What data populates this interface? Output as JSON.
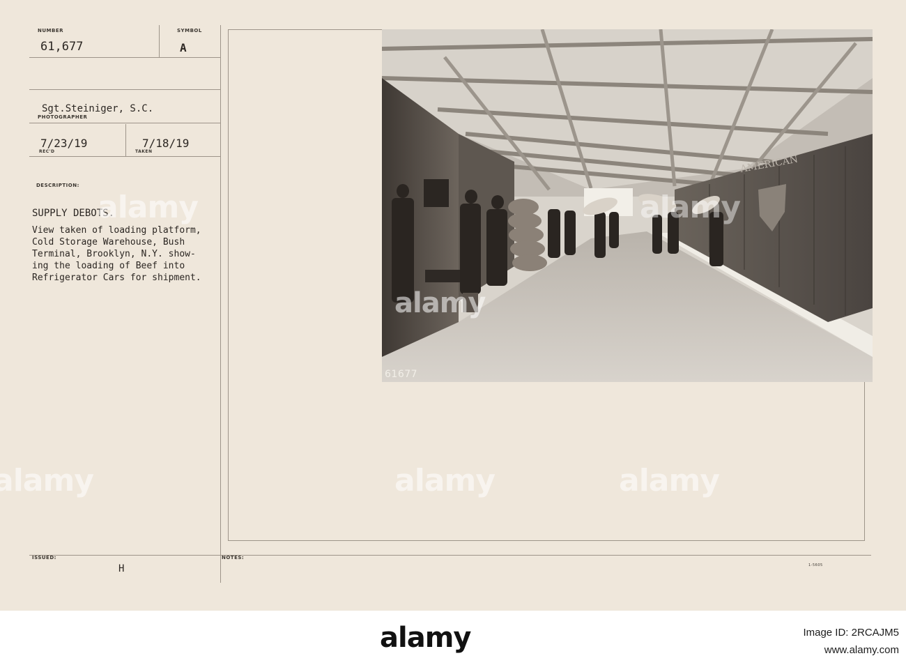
{
  "card": {
    "number_label": "NUMBER",
    "number_value": "61,677",
    "symbol_label": "SYMBOL",
    "symbol_value": "A",
    "photographer_value": "Sgt.Steiniger, S.C.",
    "photographer_label": "PHOTOGRAPHER",
    "received_value": "7/23/19",
    "received_label": "REC'D",
    "taken_value": "7/18/19",
    "taken_label": "TAKEN",
    "description_label": "DESCRIPTION:",
    "description_title": "SUPPLY DEBOTS.",
    "description_lines": [
      "View taken of loading platform,",
      "Cold Storage Warehouse, Bush",
      "Terminal, Brooklyn, N.Y. show-",
      "ing the loading of Beef into",
      "Refrigerator Cars for shipment."
    ],
    "issued_label": "ISSUED:",
    "issued_value": "H",
    "notes_label": "NOTES:",
    "form_code": "1-5605"
  },
  "photo": {
    "negative_number": "61677",
    "car_lettering": "AMERICAN"
  },
  "watermark": {
    "text": "alamy"
  },
  "stock_strip": {
    "logo": "alamy",
    "image_id_line": "Image ID: 2RCAJM5",
    "site": "www.alamy.com"
  }
}
